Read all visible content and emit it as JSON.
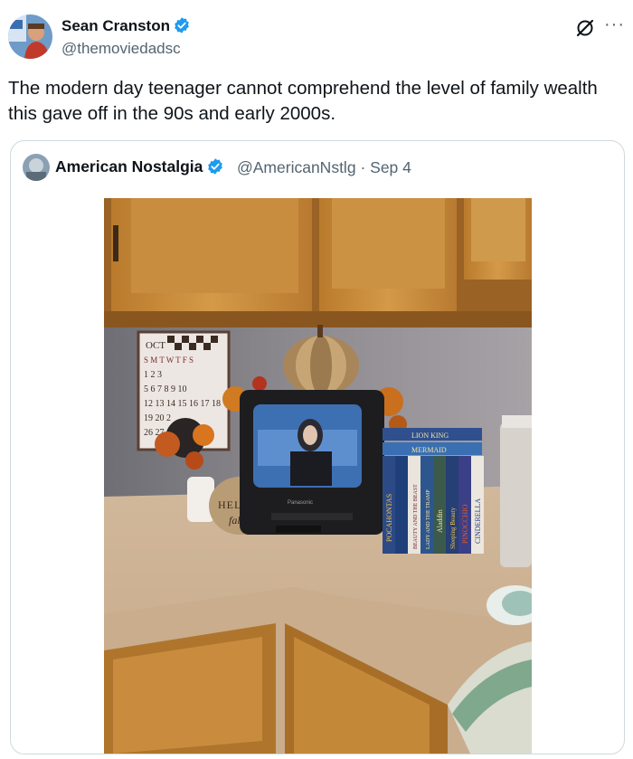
{
  "tweet": {
    "author_name": "Sean Cranston",
    "author_handle": "@themoviedadsc",
    "text": "The modern day teenager cannot comprehend the level of family wealth this gave off in the 90s and early 2000s.",
    "more_label": "···"
  },
  "quoted": {
    "author_name": "American Nostalgia",
    "author_handle": "@AmericanNstlg",
    "separator": "·",
    "date": "Sep 4",
    "photo": {
      "calendar_month": "OCT",
      "calendar_weekdays": "S M T W T F S",
      "calendar_rows": [
        "1 2 3",
        "5 6 7 8 9 10",
        "12 13 14 15 16 17 18",
        "19 20 2",
        "26 27"
      ],
      "sign_line1": "HELLO",
      "sign_line2": "fall",
      "tv_brand": "Panasonic",
      "vhs_titles": [
        "LION KING",
        "MERMAID",
        "POCAHONTAS",
        "BEAUTY AND THE BEAST",
        "LADY AND THE TRAMP",
        "Aladdin",
        "Sleeping Beauty",
        "PINOCCHIO",
        "CINDERELLA"
      ]
    }
  },
  "colors": {
    "verified_blue": "#1d9bf0",
    "text_primary": "#0f1419",
    "text_secondary": "#536471",
    "border": "#cfd9de"
  }
}
